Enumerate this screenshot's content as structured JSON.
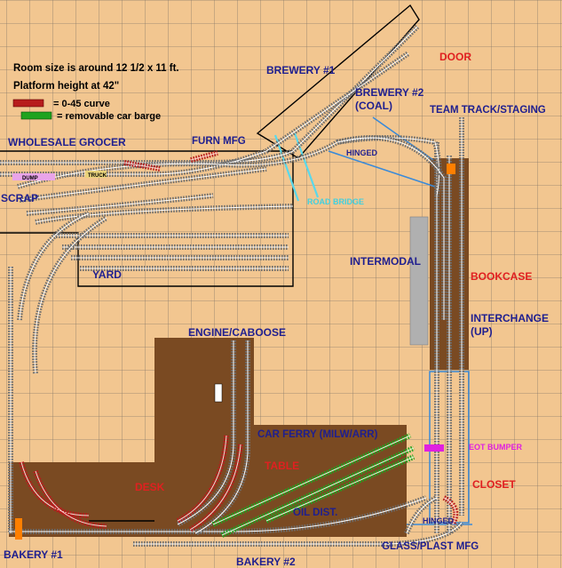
{
  "notes": {
    "room_size": "Room size is around 12 1/2 x 11 ft.",
    "platform_height": "Platform height at 42\"",
    "legend_curve": "= 0-45 curve",
    "legend_barge": "= removable car barge"
  },
  "labels": {
    "door": "DOOR",
    "brewery1": "BREWERY #1",
    "brewery2": "BREWERY #2",
    "coal": "(COAL)",
    "team_track": "TEAM TRACK/STAGING",
    "wholesale_grocer": "WHOLESALE GROCER",
    "furn_mfg": "FURN MFG",
    "hinged_top": "HINGED",
    "scrap": "SCRAP",
    "dump": "DUMP",
    "truck": "TRUCK",
    "road_bridge": "ROAD BRIDGE",
    "intermodal": "INTERMODAL",
    "bookcase": "BOOKCASE",
    "yard": "YARD",
    "interchange": "INTERCHANGE",
    "interchange_up": "(UP)",
    "engine_caboose": "ENGINE/CABOOSE",
    "car_ferry": "CAR FERRY (MILW/ARR)",
    "eot_bumper": "EOT BUMPER",
    "desk": "DESK",
    "table": "TABLE",
    "closet": "CLOSET",
    "oil_dist": "OIL DIST.",
    "hinged_bottom": "HINGED",
    "bakery1": "BAKERY #1",
    "bakery2": "BAKERY #2",
    "glass_plast": "GLASS/PLAST MFG"
  },
  "colors": {
    "room": "#f2c690",
    "grid": "#8a7a6a",
    "furniture": "#7a4a22",
    "track_tie": "#6e6e6e",
    "track_rail": "#ffffff",
    "curve": "#b71c1c",
    "barge": "#1fa31f",
    "label_blue": "#1f1f8f",
    "label_red": "#e02020",
    "label_cyan": "#40d0e0",
    "label_magenta": "#e020e0",
    "intermodal": "#b0b0b0"
  }
}
